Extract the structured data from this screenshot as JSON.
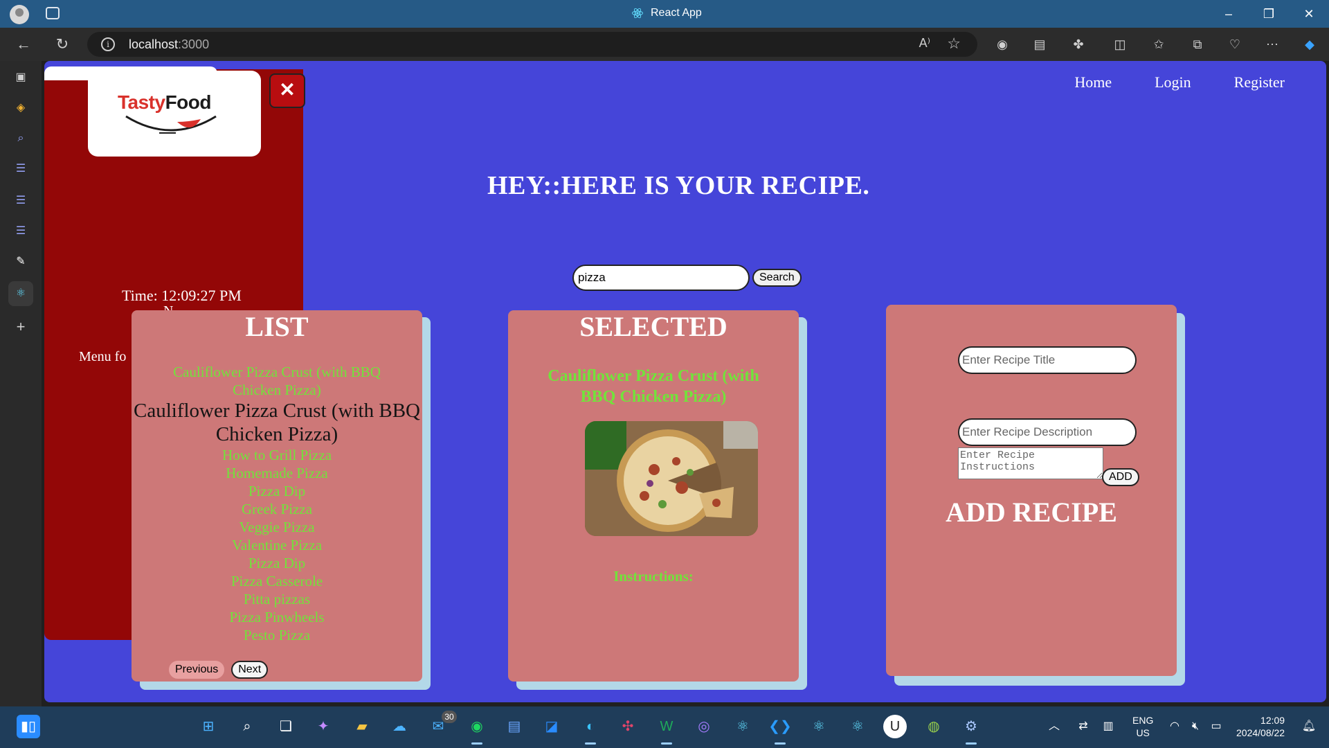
{
  "browser": {
    "window_title": "React App",
    "url_host": "localhost",
    "url_port": ":3000"
  },
  "nav": {
    "home": "Home",
    "login": "Login",
    "register": "Register"
  },
  "hero": {
    "heading": "HEY::HERE IS YOUR RECIPE."
  },
  "search": {
    "value": "pizza",
    "button": "Search"
  },
  "drawer": {
    "logo_part1": "Tasty",
    "logo_part2": "Food",
    "close_symbol": "✕",
    "time": "Time: 12:09:27 PM",
    "n_text": "N",
    "menu_text": "Menu fo"
  },
  "list": {
    "title": "LIST",
    "items": [
      "Cauliflower Pizza Crust (with BBQ Chicken Pizza)",
      "Cauliflower Pizza Crust (with BBQ Chicken Pizza)",
      "How to Grill Pizza",
      "Homemade Pizza",
      "Pizza Dip",
      "Greek Pizza",
      "Veggie Pizza",
      "Valentine Pizza",
      "Pizza Dip",
      "Pizza Casserole",
      "Pitta pizzas",
      "Pizza Pinwheels",
      "Pesto Pizza"
    ],
    "selected_index": 1,
    "previous": "Previous",
    "next": "Next"
  },
  "selected": {
    "title": "SELECTED",
    "name": "Cauliflower Pizza Crust (with BBQ Chicken Pizza)",
    "instructions_label": "Instructions:"
  },
  "add": {
    "title_placeholder": "Enter Recipe Title",
    "description_placeholder": "Enter Recipe Description",
    "instructions_placeholder": "Enter Recipe Instructions",
    "add_button": "ADD",
    "heading": "ADD RECIPE"
  },
  "taskbar": {
    "mail_badge": "30",
    "lang_line1": "ENG",
    "lang_line2": "US",
    "time": "12:09",
    "date": "2024/08/22"
  },
  "colors": {
    "page_bg": "#4545d9",
    "drawer": "#930707",
    "card": "#cd7878",
    "card_shadow": "#b3d8e8",
    "link_green": "#72e33b"
  }
}
